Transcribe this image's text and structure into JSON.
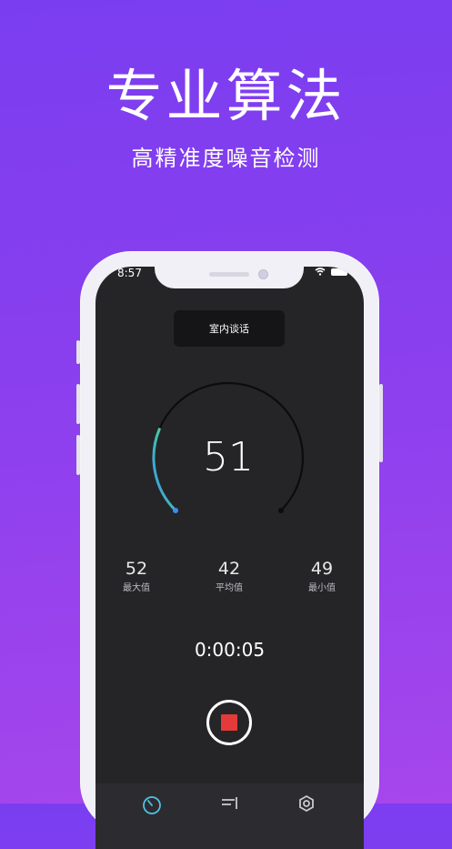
{
  "banner": {
    "title": "专业算法",
    "subtitle": "高精准度噪音检测"
  },
  "status_bar": {
    "time": "8:57"
  },
  "meter": {
    "mode": "室内谈话",
    "reading": "51",
    "level_fraction": 0.25,
    "stats": [
      {
        "value": "52",
        "label": "最大值"
      },
      {
        "value": "42",
        "label": "平均值"
      },
      {
        "value": "49",
        "label": "最小值"
      }
    ],
    "elapsed": "0:00:05"
  },
  "tabs": [
    {
      "icon": "gauge-icon",
      "active": true
    },
    {
      "icon": "list-icon",
      "active": false
    },
    {
      "icon": "settings-icon",
      "active": false
    }
  ],
  "colors": {
    "background_top": "#7a3ef0",
    "background_bottom": "#a646ec",
    "screen": "#252528",
    "record": "#e53a3a",
    "gauge_start": "#3f8cf2",
    "gauge_mid": "#3fc5b0",
    "gauge_end": "#a6cf3a",
    "active_tab": "#4fc3e8"
  }
}
